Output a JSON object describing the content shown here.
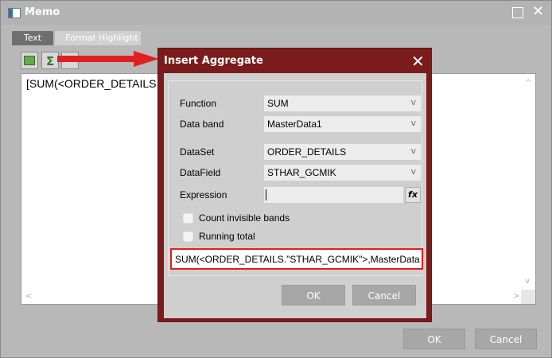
{
  "memo": {
    "title": "Memo",
    "tabs": [
      {
        "label": "Text"
      },
      {
        "label": "Format"
      },
      {
        "label": "Highlight"
      }
    ],
    "editor_text": "[SUM(<ORDER_DETAILS",
    "ok_label": "OK",
    "cancel_label": "Cancel"
  },
  "dialog": {
    "title": "Insert Aggregate",
    "fields": {
      "function": {
        "label": "Function",
        "value": "SUM"
      },
      "data_band": {
        "label": "Data band",
        "value": "MasterData1"
      },
      "dataset": {
        "label": "DataSet",
        "value": "ORDER_DETAILS"
      },
      "datafield": {
        "label": "DataField",
        "value": "STHAR_GCMIK"
      },
      "expression": {
        "label": "Expression",
        "value": ""
      }
    },
    "checkboxes": [
      {
        "label": "Count invisible bands",
        "checked": false
      },
      {
        "label": "Running total",
        "checked": false
      }
    ],
    "result": "SUM(<ORDER_DETAILS.\"STHAR_GCMIK\">,MasterData",
    "ok_label": "OK",
    "cancel_label": "Cancel"
  },
  "colors": {
    "dialog_frame": "#7a1c1c",
    "annotation_red": "#e02020"
  }
}
